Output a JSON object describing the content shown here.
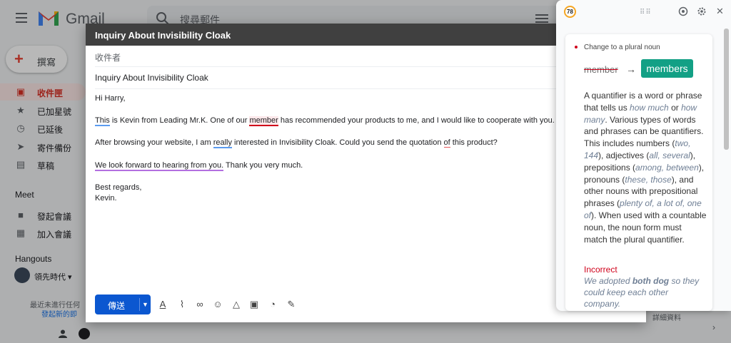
{
  "gmail": {
    "app_name": "Gmail",
    "search_placeholder": "搜尋郵件",
    "compose_label": "撰寫",
    "nav": [
      {
        "label": "收件匣",
        "icon": "inbox-icon"
      },
      {
        "label": "已加星號",
        "icon": "star-icon"
      },
      {
        "label": "已延後",
        "icon": "clock-icon"
      },
      {
        "label": "寄件備份",
        "icon": "send-icon"
      },
      {
        "label": "草稿",
        "icon": "draft-icon"
      }
    ],
    "meet_title": "Meet",
    "meet_items": [
      {
        "label": "發起會議",
        "icon": "video-icon"
      },
      {
        "label": "加入會議",
        "icon": "keyboard-icon"
      }
    ],
    "hangouts_title": "Hangouts",
    "hangouts_user": "領先時代 ▾",
    "hangouts_hint": "最近未進行任何",
    "hangouts_link": "發起新的即",
    "details_label": "詳細資料",
    "colors": {
      "accent": "#d93025",
      "send": "#0b57d0"
    }
  },
  "compose": {
    "title": "Inquiry About Invisibility Cloak",
    "to_label": "收件者",
    "subject": "Inquiry About Invisibility Cloak",
    "greeting": "Hi Harry,",
    "p1": {
      "w_this": "This",
      "a": " is Kevin from Leading Mr.K. One of our ",
      "w_member": "member",
      "b": " has recommended your products to me, and I would like to cooperate with you."
    },
    "p2": {
      "a": "After browsing your website, I am ",
      "w_really": "really",
      "b": " interested in Invisibility Cloak. Could you send the quotation ",
      "w_of": "of",
      "c": " this product?"
    },
    "p3": {
      "w_phrase": "We look forward to hearing from you.",
      "a": " Thank you very much."
    },
    "closing": "Best regards,",
    "signature": "Kevin.",
    "send_label": "傳送",
    "toolbar_icons": [
      "format-text-icon",
      "attach-icon",
      "link-icon",
      "emoji-icon",
      "drive-icon",
      "photo-icon",
      "confidential-icon",
      "signature-icon"
    ]
  },
  "grammarly": {
    "score": "78",
    "category": "Change to a plural noun",
    "original_word": "member",
    "arrow": "→",
    "suggested_word": "members",
    "explanation": {
      "t1": "A quantifier is a word or phrase that tells us ",
      "e1": "how much",
      "t2": " or ",
      "e2": "how many",
      "t3": ". Various types of words and phrases can be quantifiers. This includes numbers (",
      "e3": "two, 144",
      "t4": "), adjectives (",
      "e4": "all, several",
      "t5": "), prepositions (",
      "e5": "among, between",
      "t6": "), pronouns (",
      "e6": "these, those",
      "t7": "), and other nouns with prepositional phrases (",
      "e7": "plenty of, a lot of, one of",
      "t8": "). When used with a countable noun, the noun form must match the plural quantifier."
    },
    "incorrect_label": "Incorrect",
    "example": {
      "a": "We adopted ",
      "b": "both dog",
      "c": " so they could keep each other company."
    },
    "colors": {
      "fix": "#13a085",
      "error": "#d0021b"
    }
  }
}
